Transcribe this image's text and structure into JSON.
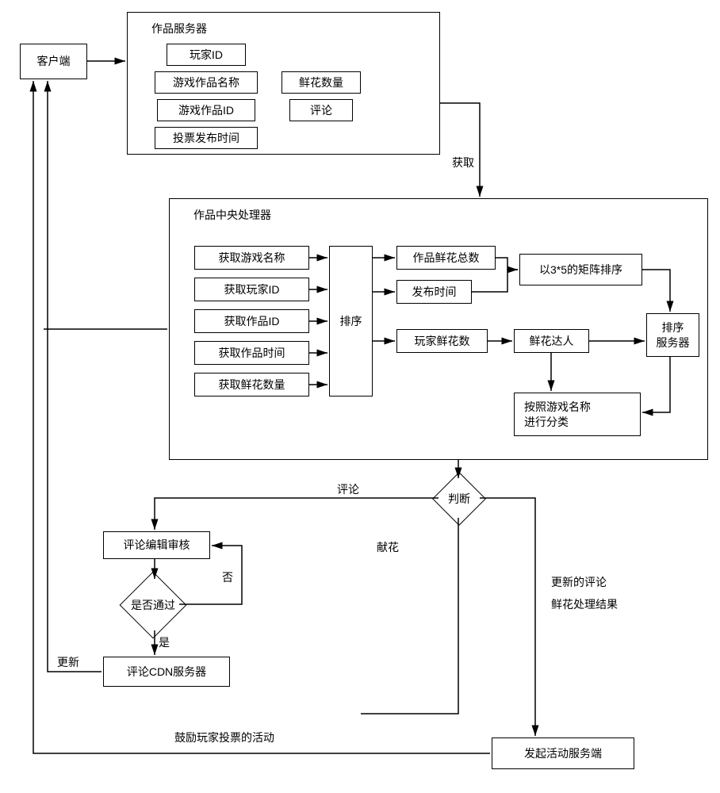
{
  "client": "客户端",
  "works_server": {
    "title": "作品服务器",
    "player_id": "玩家ID",
    "work_name": "游戏作品名称",
    "work_id": "游戏作品ID",
    "vote_time": "投票发布时间",
    "flower_count": "鲜花数量",
    "comment": "评论"
  },
  "edge_fetch": "获取",
  "cpu": {
    "title": "作品中央处理器",
    "get_game_name": "获取游戏名称",
    "get_player_id": "获取玩家ID",
    "get_work_id": "获取作品ID",
    "get_work_time": "获取作品时间",
    "get_flower_count": "获取鲜花数量",
    "sort": "排序",
    "total_flowers": "作品鲜花总数",
    "publish_time": "发布时间",
    "player_flowers": "玩家鲜花数",
    "matrix_sort": "以3*5的矩阵排序",
    "flower_star": "鲜花达人",
    "sort_server": "排序\n服务器",
    "classify": "按照游戏名称\n进行分类"
  },
  "judge": "判断",
  "edge_comment": "评论",
  "edge_flower": "献花",
  "review": "评论编辑审核",
  "pass": "是否通过",
  "yes": "是",
  "no": "否",
  "cdn": "评论CDN服务器",
  "update": "更新",
  "update_result": "更新的评论\n鲜花处理结果",
  "encourage": "鼓励玩家投票的活动",
  "activity_server": "发起活动服务端"
}
